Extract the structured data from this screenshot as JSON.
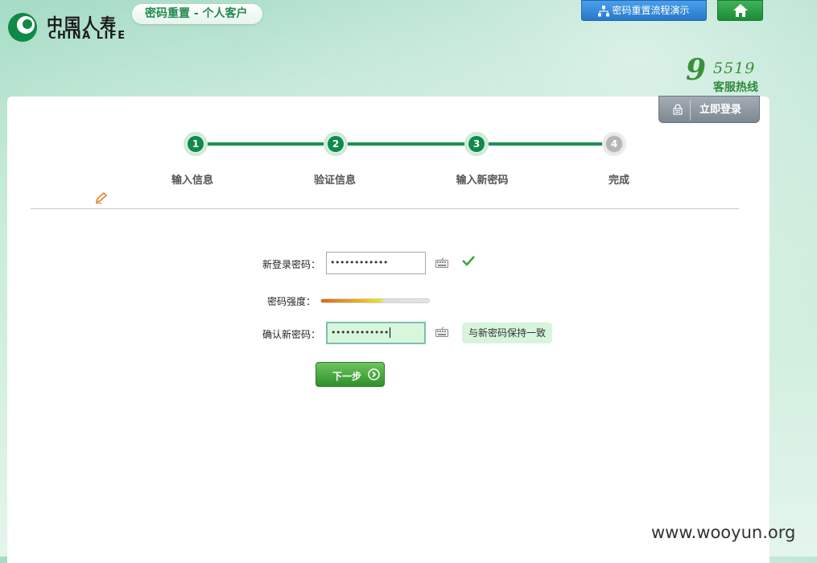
{
  "header": {
    "logo_cn": "中国人寿",
    "logo_en": "CHINA LIFE",
    "page_title": "密码重置 - 个人客户",
    "demo_button": "密码重置流程演示",
    "hotline_number_lead": "9",
    "hotline_number_rest": "5519",
    "hotline_label": "客服热线",
    "login_button": "立即登录"
  },
  "steps": [
    {
      "number": "1",
      "label": "输入信息",
      "state": "done"
    },
    {
      "number": "2",
      "label": "验证信息",
      "state": "done"
    },
    {
      "number": "3",
      "label": "输入新密码",
      "state": "current"
    },
    {
      "number": "4",
      "label": "完成",
      "state": "pending"
    }
  ],
  "form": {
    "new_password_label": "新登录密码：",
    "new_password_value": "••••••••••••",
    "strength_label": "密码强度：",
    "strength_level": 0.58,
    "confirm_label": "确认新密码：",
    "confirm_value": "••••••••••••",
    "confirm_hint": "与新密码保持一致",
    "next_button": "下一步"
  },
  "watermark": "www.wooyun.org",
  "colors": {
    "brand_green": "#108a4c",
    "demo_blue": "#2878c8",
    "input_focus_bg": "#d7f7dd"
  },
  "icons": [
    "china-life-logo-icon",
    "sitemap-icon",
    "home-icon",
    "lock-icon",
    "pencil-icon",
    "keyboard-icon",
    "check-icon",
    "arrow-right-circle-icon"
  ]
}
